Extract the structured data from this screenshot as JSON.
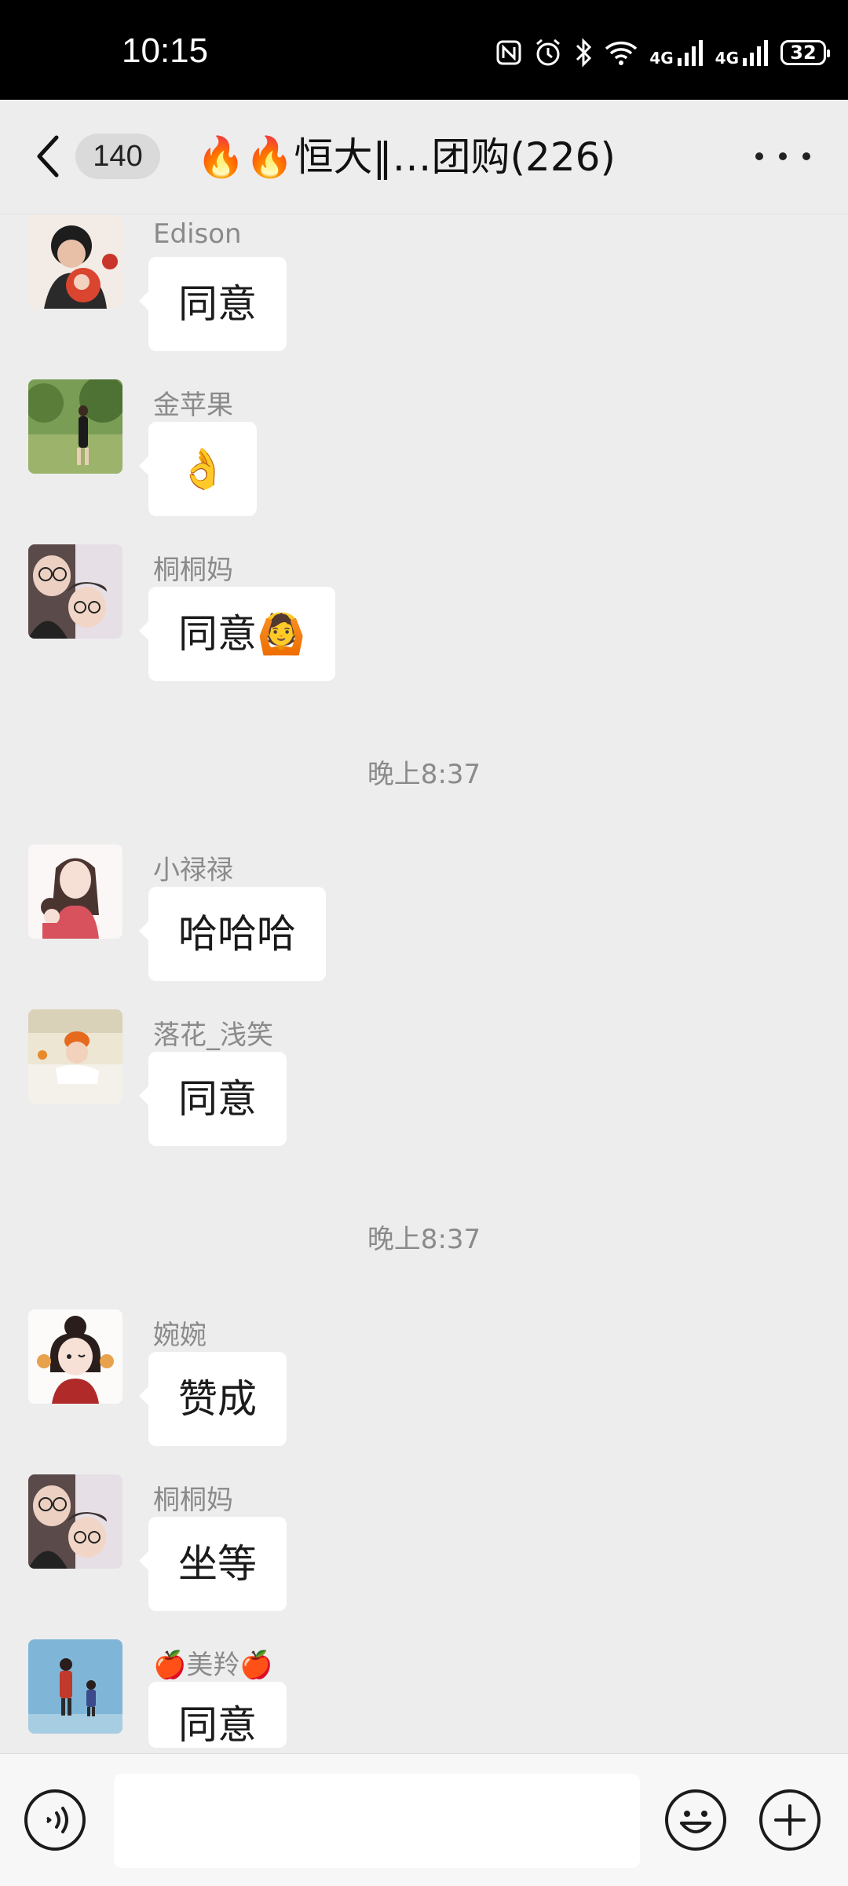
{
  "status_bar": {
    "time": "10:15",
    "battery": "32",
    "net1": "4G",
    "net2": "4G"
  },
  "header": {
    "unread_count": "140",
    "title": "🔥🔥恒大‖…团购(226)"
  },
  "messages": [
    {
      "sender": "Edison",
      "text": "同意"
    },
    {
      "sender": "金苹果",
      "text": "👌"
    },
    {
      "sender": "桐桐妈",
      "text": "同意🙆"
    },
    {
      "sender": "小禄禄",
      "text": "哈哈哈"
    },
    {
      "sender": "落花_浅笑",
      "text": "同意"
    },
    {
      "sender": "婉婉",
      "text": "赞成"
    },
    {
      "sender": "桐桐妈",
      "text": "坐等"
    },
    {
      "sender": "🍎美羚🍎",
      "text": "同意"
    }
  ],
  "time_separators": [
    "晚上8:37",
    "晚上8:37"
  ],
  "input": {
    "placeholder": ""
  },
  "icons": {
    "back": "chevron-left-icon",
    "more": "more-dots-icon",
    "voice": "voice-icon",
    "emoji": "emoji-icon",
    "plus": "plus-icon"
  }
}
